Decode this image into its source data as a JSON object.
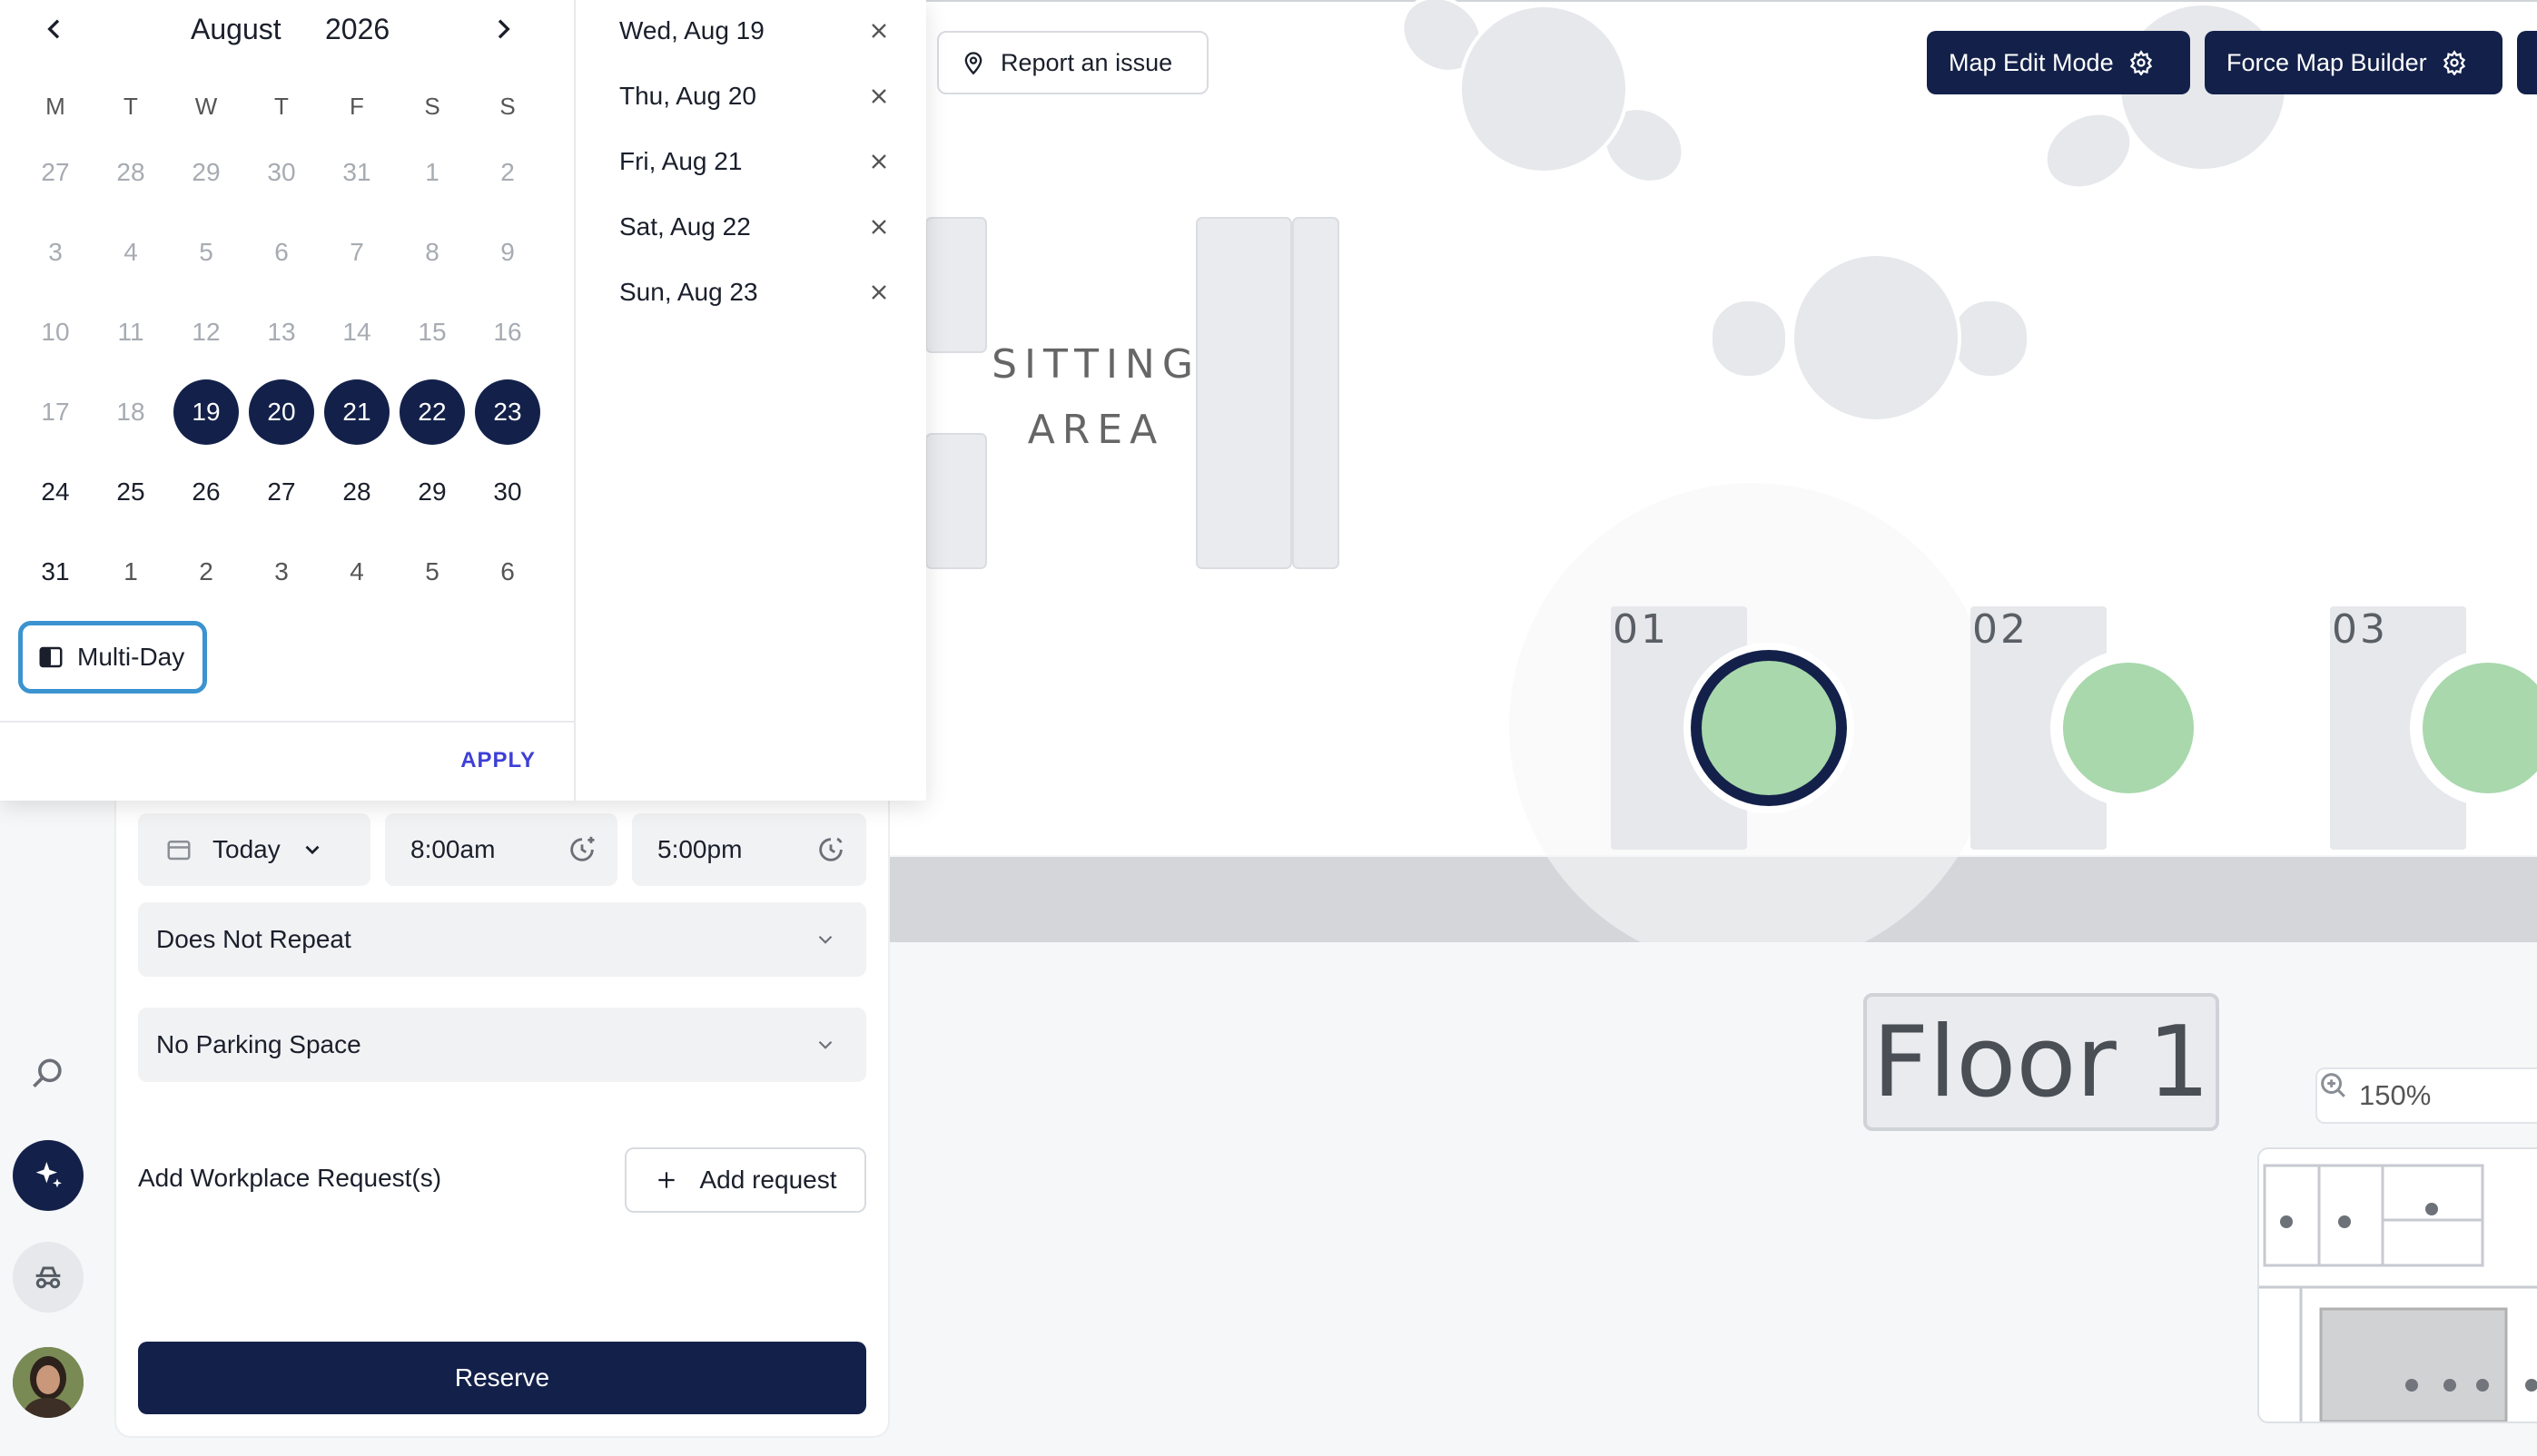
{
  "calendar": {
    "month": "August",
    "year": "2026",
    "weekdays": [
      "M",
      "T",
      "W",
      "T",
      "F",
      "S",
      "S"
    ],
    "weeks": [
      [
        "27",
        "28",
        "29",
        "30",
        "31",
        "1",
        "2"
      ],
      [
        "3",
        "4",
        "5",
        "6",
        "7",
        "8",
        "9"
      ],
      [
        "10",
        "11",
        "12",
        "13",
        "14",
        "15",
        "16"
      ],
      [
        "17",
        "18",
        "19",
        "20",
        "21",
        "22",
        "23"
      ],
      [
        "24",
        "25",
        "26",
        "27",
        "28",
        "29",
        "30"
      ],
      [
        "31",
        "1",
        "2",
        "3",
        "4",
        "5",
        "6"
      ]
    ],
    "selected_days": [
      "19",
      "20",
      "21",
      "22",
      "23"
    ],
    "multiday_label": "Multi-Day",
    "apply_label": "APPLY",
    "selected_dates": [
      "Wed, Aug 19",
      "Thu, Aug 20",
      "Fri, Aug 21",
      "Sat, Aug 22",
      "Sun, Aug 23"
    ]
  },
  "toolbar": {
    "report_label": "Report an issue",
    "map_edit_label": "Map Edit Mode",
    "force_builder_label": "Force Map Builder"
  },
  "map": {
    "sitting_area_line1": "SITTING",
    "sitting_area_line2": "AREA",
    "desk_labels": [
      "01",
      "02",
      "03"
    ],
    "floor_label": "Floor 1",
    "zoom_level": "150%",
    "available_color": "#a8d8ac",
    "selected_ring_color": "#13214a"
  },
  "booking": {
    "date_label": "Today",
    "start_time": "8:00am",
    "end_time": "5:00pm",
    "repeat_label": "Does Not Repeat",
    "parking_label": "No Parking Space",
    "workplace_request_label": "Add Workplace Request(s)",
    "add_request_label": "Add request",
    "reserve_label": "Reserve"
  }
}
